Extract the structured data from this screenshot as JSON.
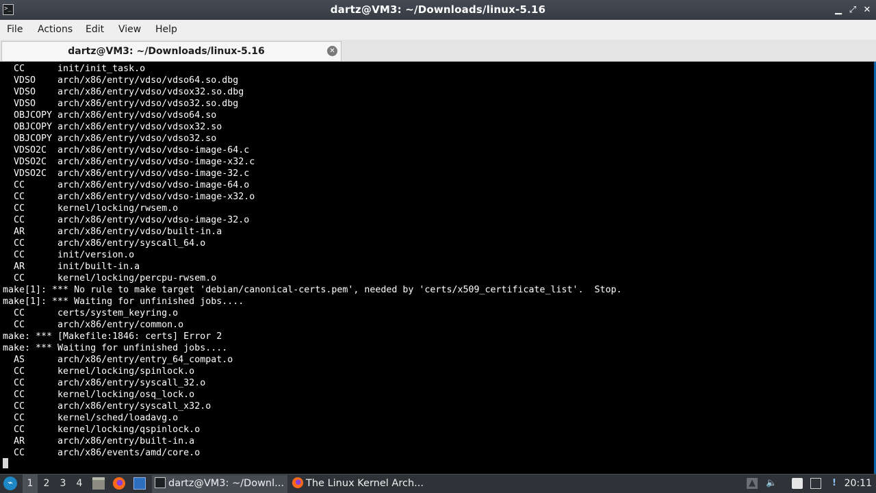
{
  "window": {
    "title": "dartz@VM3: ~/Downloads/linux-5.16",
    "app_icon": "terminal-icon",
    "buttons": {
      "minimize": "▁",
      "maximize": "⤢",
      "close": "✕"
    }
  },
  "menubar": {
    "items": [
      "File",
      "Actions",
      "Edit",
      "View",
      "Help"
    ]
  },
  "tabs": [
    {
      "label": "dartz@VM3: ~/Downloads/linux-5.16",
      "close_icon": "close-circle-icon"
    }
  ],
  "terminal": {
    "lines": [
      "  CC      init/init_task.o",
      "  VDSO    arch/x86/entry/vdso/vdso64.so.dbg",
      "  VDSO    arch/x86/entry/vdso/vdsox32.so.dbg",
      "  VDSO    arch/x86/entry/vdso/vdso32.so.dbg",
      "  OBJCOPY arch/x86/entry/vdso/vdso64.so",
      "  OBJCOPY arch/x86/entry/vdso/vdsox32.so",
      "  OBJCOPY arch/x86/entry/vdso/vdso32.so",
      "  VDSO2C  arch/x86/entry/vdso/vdso-image-64.c",
      "  VDSO2C  arch/x86/entry/vdso/vdso-image-x32.c",
      "  VDSO2C  arch/x86/entry/vdso/vdso-image-32.c",
      "  CC      arch/x86/entry/vdso/vdso-image-64.o",
      "  CC      arch/x86/entry/vdso/vdso-image-x32.o",
      "  CC      kernel/locking/rwsem.o",
      "  CC      arch/x86/entry/vdso/vdso-image-32.o",
      "  AR      arch/x86/entry/vdso/built-in.a",
      "  CC      arch/x86/entry/syscall_64.o",
      "  CC      init/version.o",
      "  AR      init/built-in.a",
      "  CC      kernel/locking/percpu-rwsem.o",
      "make[1]: *** No rule to make target 'debian/canonical-certs.pem', needed by 'certs/x509_certificate_list'.  Stop.",
      "make[1]: *** Waiting for unfinished jobs....",
      "  CC      certs/system_keyring.o",
      "  CC      arch/x86/entry/common.o",
      "make: *** [Makefile:1846: certs] Error 2",
      "make: *** Waiting for unfinished jobs....",
      "  AS      arch/x86/entry/entry_64_compat.o",
      "  CC      kernel/locking/spinlock.o",
      "  CC      arch/x86/entry/syscall_32.o",
      "  CC      kernel/locking/osq_lock.o",
      "  CC      arch/x86/entry/syscall_x32.o",
      "  CC      kernel/sched/loadavg.o",
      "  CC      kernel/locking/qspinlock.o",
      "  AR      arch/x86/entry/built-in.a",
      "  CC      arch/x86/events/amd/core.o"
    ]
  },
  "taskbar": {
    "start_icon": "start-menu-icon",
    "workspaces": [
      "1",
      "2",
      "3",
      "4"
    ],
    "active_workspace": "1",
    "launchers": [
      "file-manager-icon",
      "firefox-icon",
      "show-desktop-icon"
    ],
    "tasks": [
      {
        "label": "dartz@VM3: ~/Downl...",
        "icon": "terminal-icon",
        "active": true
      },
      {
        "label": "The Linux Kernel Arch...",
        "icon": "firefox-icon",
        "active": false
      }
    ],
    "tray": [
      "tray-up-arrow-icon",
      "volume-icon",
      "clipboard-icon",
      "network-icon",
      "update-notifier-icon"
    ],
    "clock": "20:11"
  }
}
